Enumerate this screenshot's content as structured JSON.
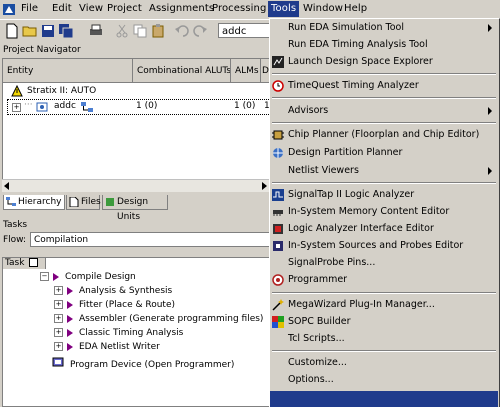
{
  "menubar": {
    "items": [
      "File",
      "Edit",
      "View",
      "Project",
      "Assignments",
      "Processing",
      "Tools",
      "Window",
      "Help"
    ],
    "active": "Tools"
  },
  "toolbar": {
    "entity_combo": "addc"
  },
  "project_navigator": {
    "title": "Project Navigator",
    "columns": [
      "Entity",
      "Combinational ALUTs",
      "ALMs",
      "D"
    ],
    "rows": [
      {
        "entity": "Stratix II: AUTO",
        "aluts": "",
        "alms": ""
      },
      {
        "entity": "addc",
        "aluts": "1 (0)",
        "alms": "1 (0)",
        "extra": "1"
      }
    ],
    "tabs": [
      "Hierarchy",
      "Files",
      "Design Units"
    ]
  },
  "tasks": {
    "title": "Tasks",
    "flow_label": "Flow:",
    "flow_value": "Compilation",
    "header": "Task",
    "items": [
      {
        "label": "Compile Design",
        "level": 0
      },
      {
        "label": "Analysis & Synthesis",
        "level": 1
      },
      {
        "label": "Fitter (Place & Route)",
        "level": 1
      },
      {
        "label": "Assembler (Generate programming files)",
        "level": 1
      },
      {
        "label": "Classic Timing Analysis",
        "level": 1
      },
      {
        "label": "EDA Netlist Writer",
        "level": 1
      },
      {
        "label": "Program Device (Open Programmer)",
        "level": 0
      }
    ]
  },
  "tools_menu": {
    "items": [
      {
        "label": "Run EDA Simulation Tool",
        "submenu": true,
        "icon": "none"
      },
      {
        "label": "Run EDA Timing Analysis Tool",
        "submenu": false,
        "icon": "none"
      },
      {
        "label": "Launch Design Space Explorer",
        "submenu": false,
        "icon": "dse-icon"
      },
      {
        "label": "TimeQuest Timing Analyzer",
        "submenu": false,
        "icon": "clock-icon"
      },
      {
        "label": "Advisors",
        "submenu": true,
        "icon": "none"
      },
      {
        "label": "Chip Planner (Floorplan and Chip Editor)",
        "submenu": false,
        "icon": "chip-icon"
      },
      {
        "label": "Design Partition Planner",
        "submenu": false,
        "icon": "partition-icon"
      },
      {
        "label": "Netlist Viewers",
        "submenu": true,
        "icon": "none"
      },
      {
        "label": "SignalTap II Logic Analyzer",
        "submenu": false,
        "icon": "signaltap-icon"
      },
      {
        "label": "In-System Memory Content Editor",
        "submenu": false,
        "icon": "memory-icon"
      },
      {
        "label": "Logic Analyzer Interface Editor",
        "submenu": false,
        "icon": "lai-icon"
      },
      {
        "label": "In-System Sources and Probes Editor",
        "submenu": false,
        "icon": "probes-icon"
      },
      {
        "label": "SignalProbe Pins...",
        "submenu": false,
        "icon": "none"
      },
      {
        "label": "Programmer",
        "submenu": false,
        "icon": "programmer-icon"
      },
      {
        "label": "MegaWizard Plug-In Manager...",
        "submenu": false,
        "icon": "megawizard-icon"
      },
      {
        "label": "SOPC Builder",
        "submenu": false,
        "icon": "sopc-icon"
      },
      {
        "label": "Tcl Scripts...",
        "submenu": false,
        "icon": "tcl-icon"
      },
      {
        "label": "Customize...",
        "submenu": false,
        "icon": "none"
      },
      {
        "label": "Options...",
        "submenu": false,
        "icon": "none"
      }
    ]
  },
  "colors": {
    "menu_highlight": "#1f3b8c",
    "chrome": "#d4d0c8",
    "task_arrow": "#800080"
  }
}
